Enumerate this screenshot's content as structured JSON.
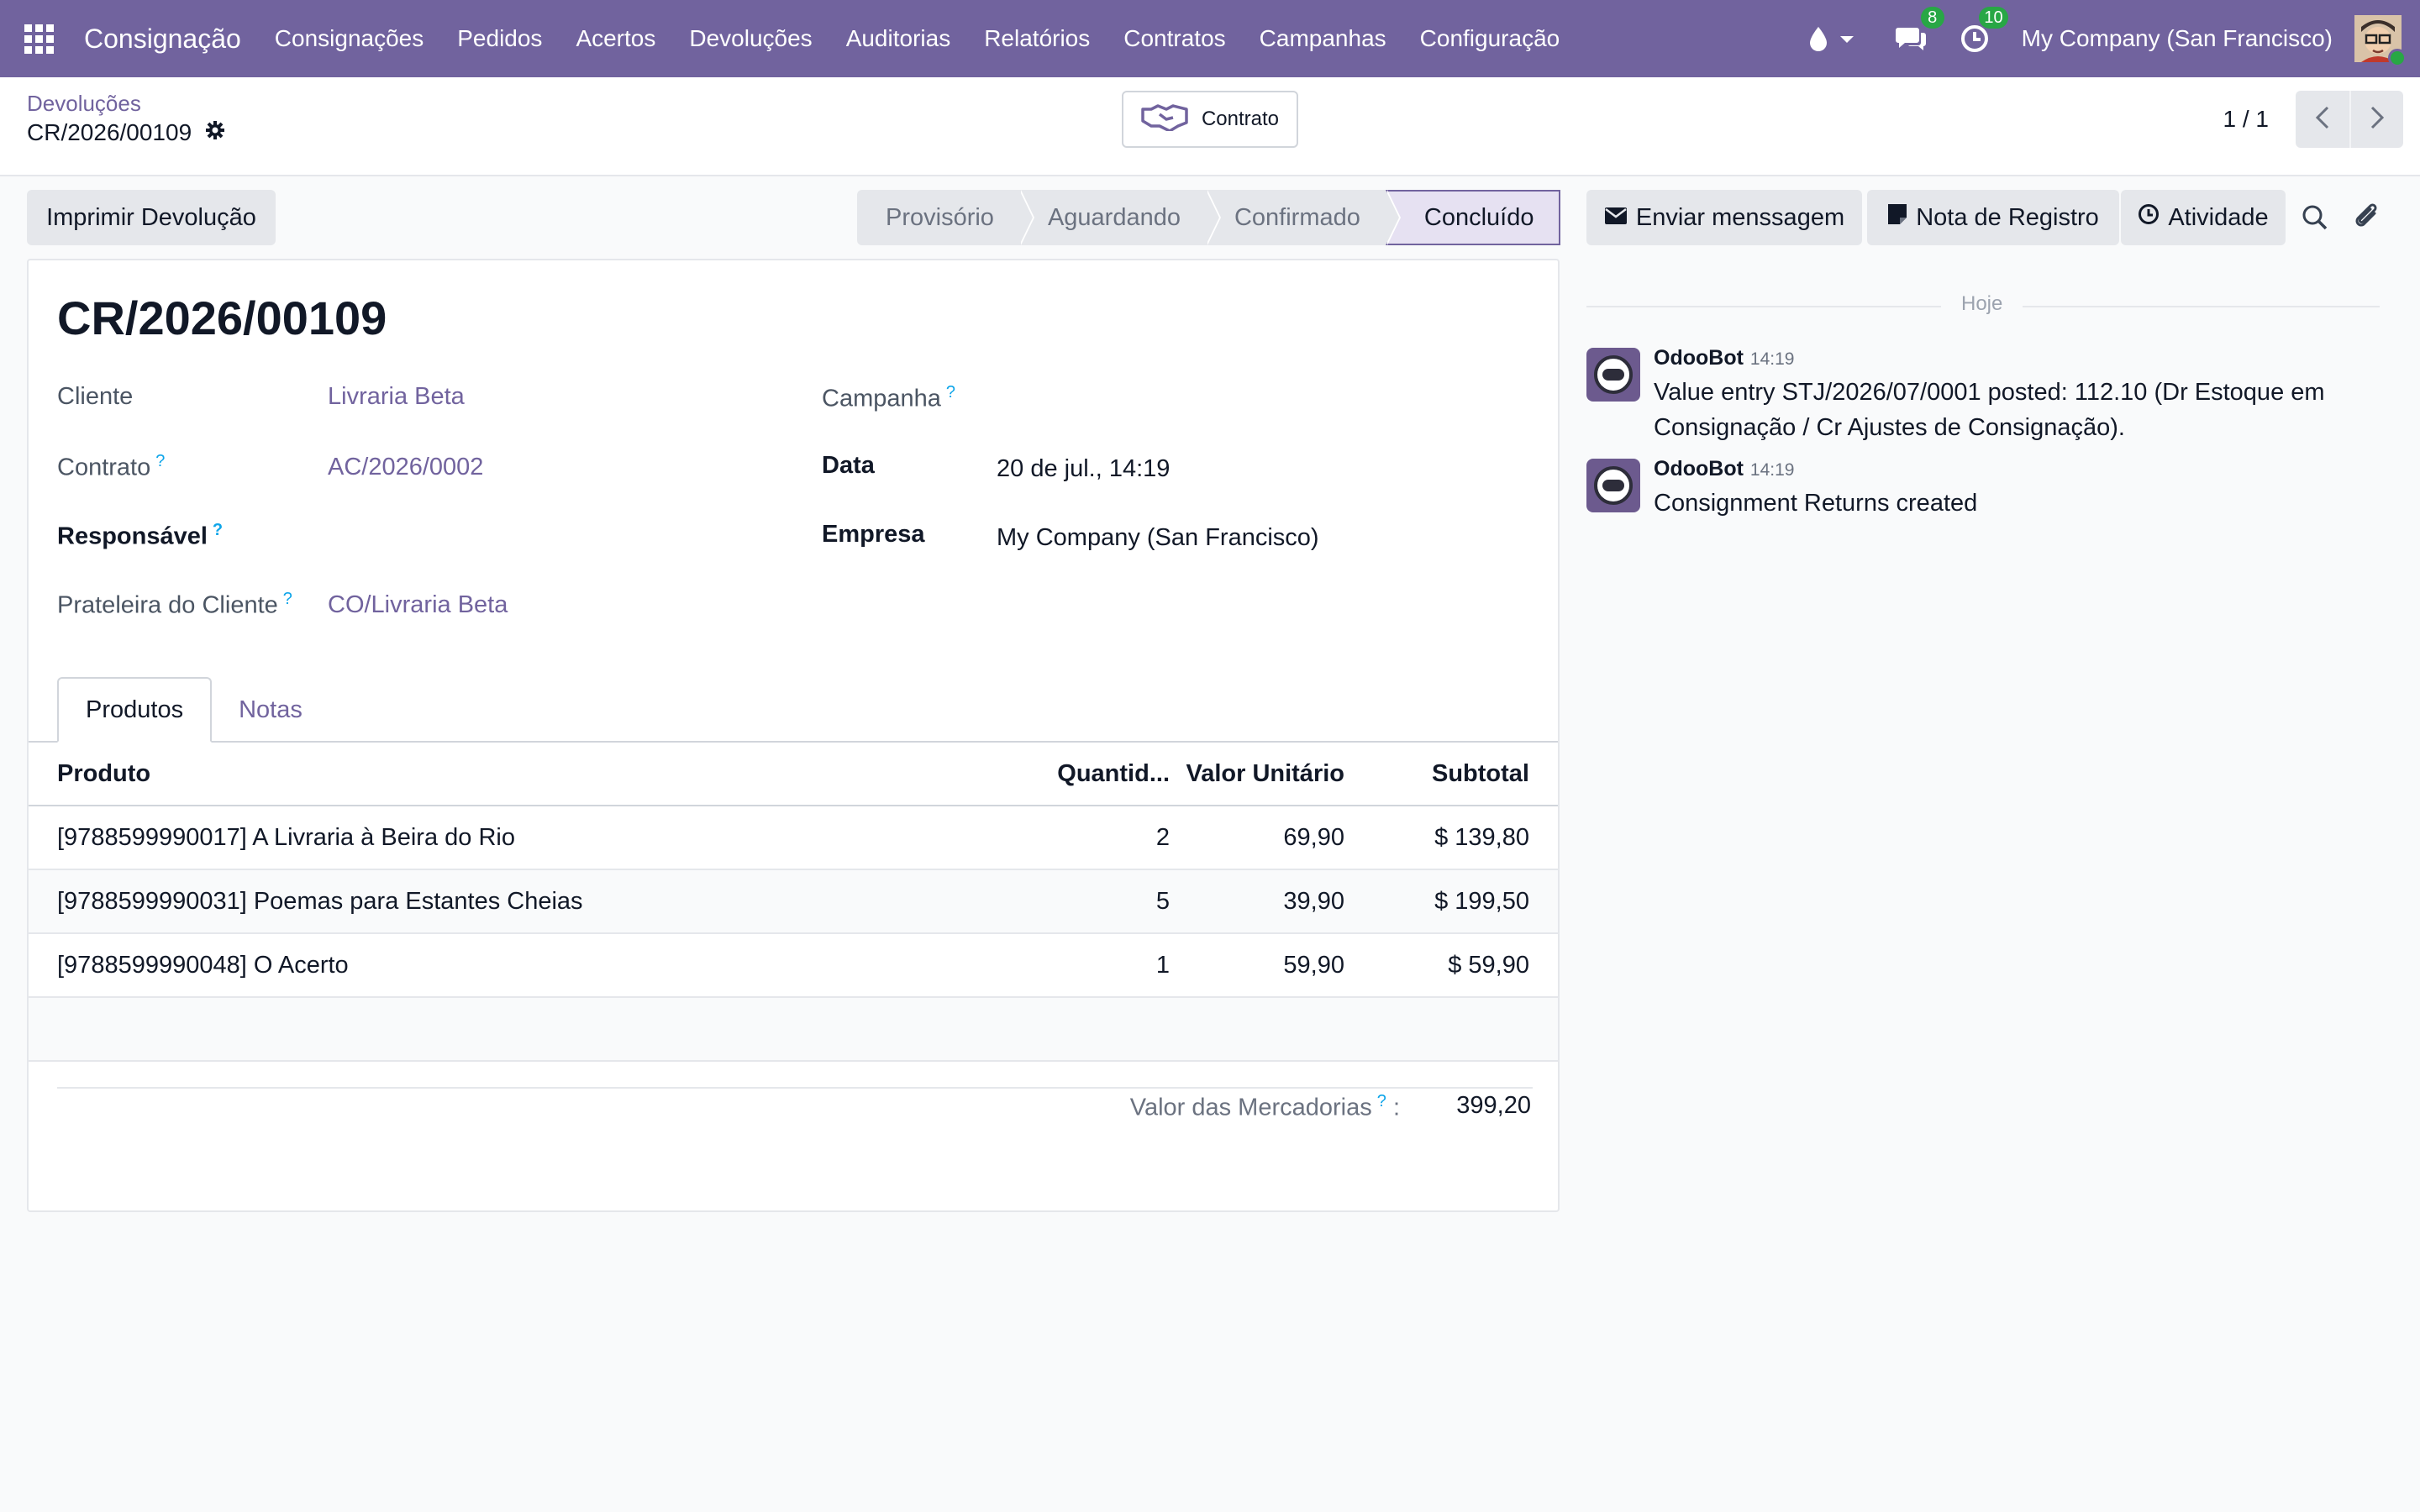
{
  "navbar": {
    "app_name": "Consignação",
    "menu": [
      "Consignações",
      "Pedidos",
      "Acertos",
      "Devoluções",
      "Auditorias",
      "Relatórios",
      "Contratos",
      "Campanhas",
      "Configuração"
    ],
    "messages_count": "8",
    "activities_count": "10",
    "company": "My Company (San Francisco)",
    "accent": "#71639e"
  },
  "control_panel": {
    "breadcrumb_parent": "Devoluções",
    "breadcrumb_current": "CR/2026/00109",
    "contract_button": "Contrato",
    "pager": "1 / 1"
  },
  "actions": {
    "print": "Imprimir Devolução"
  },
  "statusbar": {
    "stages": [
      "Provisório",
      "Aguardando",
      "Confirmado",
      "Concluído"
    ],
    "active": "Concluído"
  },
  "form": {
    "title": "CR/2026/00109",
    "fields": {
      "cliente_label": "Cliente",
      "cliente_value": "Livraria Beta",
      "contrato_label": "Contrato",
      "contrato_value": "AC/2026/0002",
      "responsavel_label": "Responsável",
      "prateleira_label": "Prateleira do Cliente",
      "prateleira_value": "CO/Livraria Beta",
      "campanha_label": "Campanha",
      "data_label": "Data",
      "data_value": "20 de jul., 14:19",
      "empresa_label": "Empresa",
      "empresa_value": "My Company (San Francisco)",
      "help_mark": "?"
    },
    "tabs": [
      "Produtos",
      "Notas"
    ],
    "table": {
      "headers": [
        "Produto",
        "Quantid...",
        "Valor Unitário",
        "Subtotal"
      ],
      "rows": [
        {
          "produto": "[9788599990017] A Livraria à Beira do Rio",
          "qty": "2",
          "unit": "69,90",
          "subtotal": "$ 139,80"
        },
        {
          "produto": "[9788599990031] Poemas para Estantes Cheias",
          "qty": "5",
          "unit": "39,90",
          "subtotal": "$ 199,50"
        },
        {
          "produto": "[9788599990048] O Acerto",
          "qty": "1",
          "unit": "59,90",
          "subtotal": "$ 59,90"
        }
      ]
    },
    "total_label": "Valor das Mercadorias",
    "total_colon": ":",
    "total_value": "399,20"
  },
  "chatter": {
    "send_message": "Enviar menssagem",
    "log_note": "Nota de Registro",
    "activity": "Atividade",
    "today": "Hoje",
    "messages": [
      {
        "author": "OdooBot",
        "time": "14:19",
        "body": "Value entry STJ/2026/07/0001 posted: 112.10 (Dr Estoque em Consignação / Cr Ajustes de Consignação)."
      },
      {
        "author": "OdooBot",
        "time": "14:19",
        "body": "Consignment Returns created"
      }
    ]
  }
}
